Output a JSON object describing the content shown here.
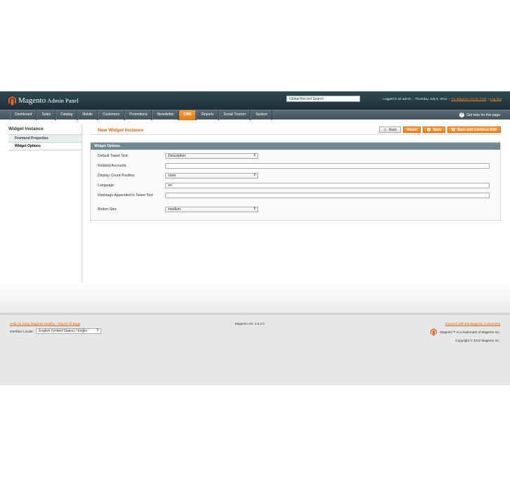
{
  "header": {
    "logo_text": "Magento",
    "logo_sub": "Admin Panel",
    "search_value": "Global Record Search",
    "logged_in": "Logged in as admin",
    "date": "Thursday, July 5, 2012",
    "try_link": "Try Magento Go for Free",
    "logout": "Log Out"
  },
  "nav": {
    "items": [
      "Dashboard",
      "Sales",
      "Catalog",
      "Mobile",
      "Customers",
      "Promotions",
      "Newsletter",
      "CMS",
      "Reports",
      "Social Tracker",
      "System"
    ],
    "active": "CMS",
    "help": "Get help for this page"
  },
  "sidebar": {
    "title": "Widget Instance",
    "tabs": [
      "Frontend Properties",
      "Widget Options"
    ]
  },
  "content": {
    "title": "New Widget Instance",
    "buttons": {
      "back": "Back",
      "reset": "Reset",
      "save": "Save",
      "save_continue": "Save and Continue Edit"
    },
    "fieldset_title": "Widget Options",
    "fields": {
      "tweet_text_label": "Default Tweet Text",
      "tweet_text_value": "Description",
      "related_label": "Related Accounts",
      "related_value": "",
      "count_label": "Display Count Position",
      "count_value": "none",
      "language_label": "Language",
      "language_value": "en",
      "hashtags_label": "Hashtags Appended to Tweet Text",
      "hashtags_value": "",
      "size_label": "Button Size",
      "size_value": "medium"
    }
  },
  "footer": {
    "help_link": "Help Us Keep Magento Healthy - Report All Bugs",
    "locale_label": "Interface Locale:",
    "locale_value": "English (United States) / Englis",
    "version": "Magento ver. 1.6.2.0",
    "community_link": "Connect with the Magento Community",
    "trademark": "Magento™ is a trademark of Magento Inc.",
    "copyright": "Copyright © 2012 Magento Inc."
  },
  "colors": {
    "accent": "#eb5e00",
    "header": "#243a42",
    "legend": "#6f8992"
  }
}
